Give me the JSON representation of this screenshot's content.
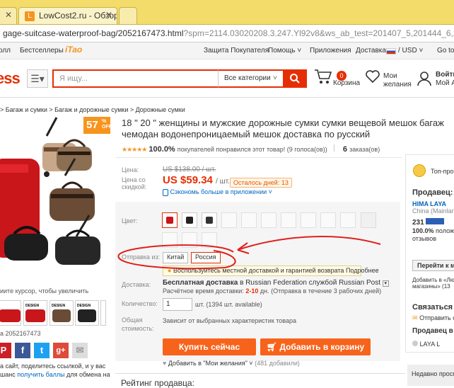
{
  "browser": {
    "tabs": [
      {
        "label": "gage-suitcase-waterproof-bag/2052167473.html?spm=...",
        "favicon": ""
      },
      {
        "label": "LowCost2.ru - Обзор",
        "favicon": "L"
      }
    ],
    "address_path": "gage-suitcase-waterproof-bag/2052167473.html",
    "address_query": "?spm=2114.03020208.3.247.Yl92v8&ws_ab_test=201407_5,201444_6,201409"
  },
  "topnav": {
    "left": [
      "олл",
      "Бестселлеры"
    ],
    "itao": "iTao",
    "right": [
      "Защита Покупателя",
      "Помощь ˅",
      "Приложения",
      "Доставка в",
      "/ USD ˅",
      "Go to G"
    ]
  },
  "header": {
    "logo": "ess",
    "search_placeholder": "Я ищу...",
    "category_select": "Все категории",
    "cart_count": "0",
    "cart_label": "Корзина",
    "wish_label_1": "Мои",
    "wish_label_2": "желания",
    "login_1": "Войти",
    "login_2": "Мой А"
  },
  "breadcrumb": "> Багаж и сумки > Багаж и дорожные сумки > Дорожные сумки",
  "gallery": {
    "discount": "57",
    "discount_unit": "%",
    "discount_off": "OFF",
    "zoom_hint": "иите курсор, чтобы увеличить",
    "thumb_labels": [
      "",
      "DESIGN",
      "DESIGN",
      "DESIGN",
      "DESIGN"
    ],
    "item_no": "а 2052167473",
    "share_text_1": "а сайт, поделитесь ссылкой, и у вас",
    "share_text_2a": "шанс ",
    "share_link": "получить баллы",
    "share_text_2b": " для обмена на"
  },
  "social": [
    "P",
    "f",
    "t",
    "g+",
    "✉"
  ],
  "product": {
    "title": "18 \" 20 \" женщины и мужские дорожные сумки сумки вещевой мешок багаж чемодан водонепроницаемый мешок доставка по русский",
    "rating_pct": "100.0%",
    "rating_text": "покупателей понравился этот товар! (9 голоса(ов))",
    "orders_count": "6",
    "orders_label": "заказа(ов)",
    "price_label": "Цена:",
    "discount_label_1": "Цена со",
    "discount_label_2": "скидкой:",
    "old_price": "US $138.00 / шт.",
    "new_price": "US $59.34",
    "new_price_unit": "/ шт.",
    "timer": "Осталось дней: 13",
    "app_saving": "Сэкономь больше в приложении ˅",
    "color_label": "Цвет:",
    "ship_from_label": "Отправка из:",
    "ship_from_options": [
      "Китай",
      "Россия"
    ],
    "local_tip": "Воспользуйтесь местной доставкой и гарантией возврата",
    "local_tip_link": "Подробнее",
    "delivery_label": "Доставка:",
    "delivery_free": "Бесплатная доставка",
    "delivery_in": "в",
    "delivery_country": "Russian Federation службой Russian Post",
    "delivery_time_pre": "Расчётное время доставки:",
    "delivery_time": "2-10",
    "delivery_time_post": "дн. (Отправка в течение 3 рабочих дней)",
    "qty_label": "Количество:",
    "qty_value": "1",
    "qty_unit": "шт.",
    "qty_available": "(1394 шт. available)",
    "total_label_1": "Общая",
    "total_label_2": "стоимость:",
    "total_note": "Зависит от выбранных характеристик товара",
    "buy_now": "Купить сейчас",
    "add_cart": "Добавить в корзину",
    "wishlist": "Добавить в \"Мои желания\" ˅",
    "wish_count": "(481 добавили)",
    "rating_section": "Рейтинг продавца:"
  },
  "seller": {
    "top_label": "Топ-про",
    "seller_label": "Продавец:",
    "seller_name": "HIMA LAYA",
    "seller_country": "China (Mainland)",
    "score": "231",
    "positive": "100.0%",
    "positive_label": "положи",
    "reviews": "отзывов",
    "go_store": "Перейти к ма",
    "add_to_fav_1": "Добавить в «Лю",
    "add_to_fav_2": "магазины» (13",
    "contact": "Связаться с",
    "send_msg": "Отправить с",
    "seller_in": "Продавец в с",
    "laya": "LAYA L",
    "recent": "Недавно просм"
  },
  "colors": {
    "accent": "#e62e04",
    "orange": "#f7631b",
    "chrome": "#f4dc6a",
    "link": "#0066c0",
    "annotation": "#e0201a"
  }
}
